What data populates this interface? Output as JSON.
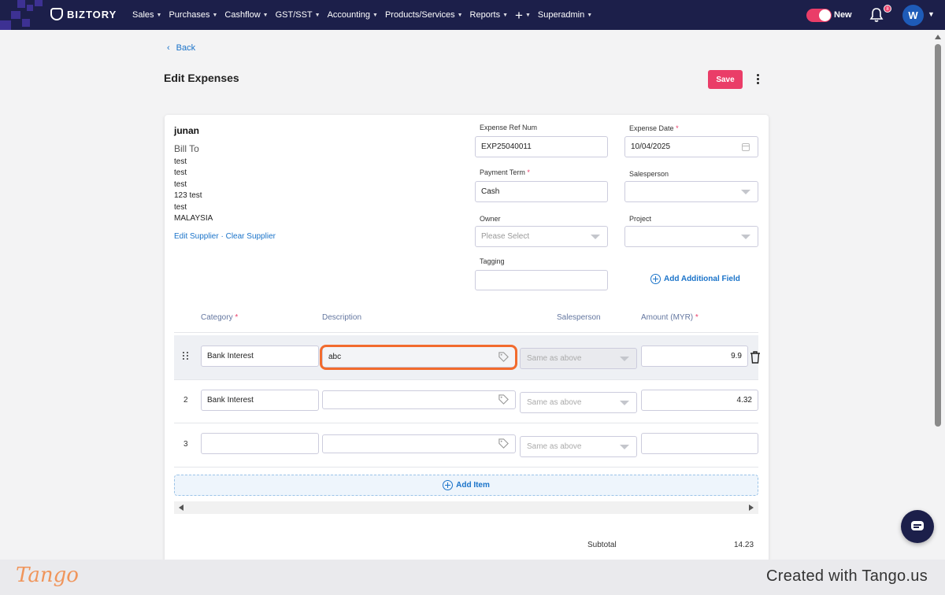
{
  "nav": {
    "brand": "BIZTORY",
    "menu": [
      "Sales",
      "Purchases",
      "Cashflow",
      "GST/SST",
      "Accounting",
      "Products/Services",
      "Reports",
      "+",
      "Superadmin"
    ],
    "toggle_label": "New",
    "notification_count": "8",
    "avatar_initial": "W"
  },
  "page": {
    "back_label": "Back",
    "title": "Edit Expenses",
    "save_label": "Save"
  },
  "supplier": {
    "name": "junan",
    "bill_to_label": "Bill To",
    "address": [
      "test",
      "test",
      "test",
      "123 test",
      "test",
      "MALAYSIA"
    ],
    "edit_label": "Edit Supplier",
    "separator": " · ",
    "clear_label": "Clear Supplier"
  },
  "form": {
    "ref_num_label": "Expense Ref Num",
    "ref_num_value": "EXP25040011",
    "date_label": "Expense Date",
    "date_value": "10/04/2025",
    "payment_term_label": "Payment Term",
    "payment_term_value": "Cash",
    "salesperson_label": "Salesperson",
    "salesperson_value": "",
    "owner_label": "Owner",
    "owner_placeholder": "Please Select",
    "project_label": "Project",
    "project_value": "",
    "tagging_label": "Tagging",
    "tagging_value": "",
    "add_field_label": "Add Additional Field",
    "required_mark": "*"
  },
  "table": {
    "headers": {
      "category": "Category",
      "description": "Description",
      "salesperson": "Salesperson",
      "amount": "Amount (MYR)"
    },
    "rows": [
      {
        "num": "",
        "category": "Bank Interest",
        "description": "abc",
        "salesperson": "Same as above",
        "amount": "9.9"
      },
      {
        "num": "2",
        "category": "Bank Interest",
        "description": "",
        "salesperson": "Same as above",
        "amount": "4.32"
      },
      {
        "num": "3",
        "category": "",
        "description": "",
        "salesperson": "Same as above",
        "amount": ""
      }
    ],
    "add_item_label": "Add Item"
  },
  "totals": {
    "subtotal_label": "Subtotal",
    "subtotal_value": "14.23"
  },
  "footer": {
    "logo_text": "Tango",
    "credit": "Created with Tango.us"
  },
  "colors": {
    "nav_bg": "#1c1f4a",
    "accent": "#ea3d68",
    "link": "#1a73c9",
    "highlight": "#f26b2e"
  }
}
